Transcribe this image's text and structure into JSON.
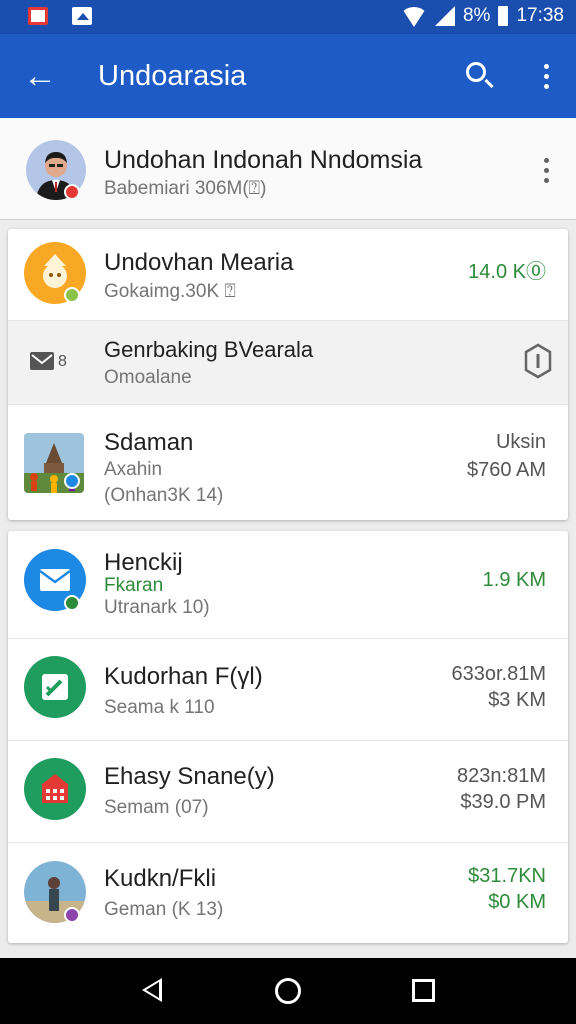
{
  "status_bar": {
    "battery_percent": "8%",
    "time": "17:38"
  },
  "app_bar": {
    "title": "Undoarasia"
  },
  "profile": {
    "name": "Undohan Indonah Nndomsia",
    "subtitle": "Babemiari 306M(⍰)"
  },
  "card1": [
    {
      "title": "Undovhan Mearia",
      "sub": "Gokaimg.30K ⍰",
      "amount": "14.0 K⓪"
    },
    {
      "title": "Genrbaking BVearala",
      "sub": "Omoalane"
    },
    {
      "title": "Sdaman",
      "sub": "Axahin",
      "sub2": "(Onhan3K 14)",
      "amount": "Uksin",
      "amount2": "$760 AM"
    }
  ],
  "card2": [
    {
      "title": "Henckij",
      "sub_green": "Fkaran",
      "sub": "Utranark 10)",
      "amount": "1.9 KM"
    },
    {
      "title": "Kudorhan F(γl)",
      "sub": "Seama k 110",
      "amount": "633or.81M",
      "amount2": "$3 KM"
    },
    {
      "title": "Ehasy Snane(y)",
      "sub": "Semam (07)",
      "amount": "823n:81M",
      "amount2": "$39.0 PM"
    },
    {
      "title": "Kudkn/Fkli",
      "sub": "Geman (K 13)",
      "amount": "$31.7KN",
      "amount2": "$0 KM"
    }
  ],
  "colors": {
    "app_bar": "#1e5bc6",
    "status_bar": "#1a4fb0",
    "amount_green": "#2e8b3a"
  },
  "icons": {
    "back": "arrow-left-icon",
    "search": "search-icon",
    "more": "more-vert-icon",
    "hex": "hexagon-info-icon"
  }
}
